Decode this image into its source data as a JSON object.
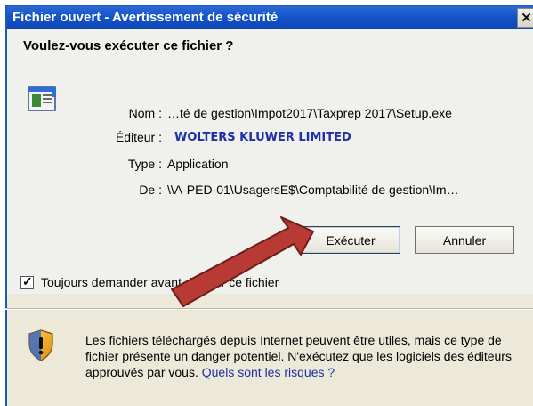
{
  "window": {
    "title": "Fichier ouvert - Avertissement de sécurité",
    "close_label": "✕"
  },
  "dialog": {
    "question": "Voulez-vous exécuter ce fichier ?",
    "details": {
      "name_label": "Nom :",
      "name_value": "…té de gestion\\Impot2017\\Taxprep 2017\\Setup.exe",
      "publisher_label": "Éditeur :",
      "publisher_value": "WOLTERS KLUWER LIMITED",
      "type_label": "Type :",
      "type_value": "Application",
      "from_label": "De :",
      "from_value": "\\\\A-PED-01\\UsagersE$\\Comptabilité de gestion\\Im…"
    },
    "buttons": {
      "run_label": "Exécuter",
      "cancel_label": "Annuler"
    },
    "checkbox": {
      "label": "Toujours demander avant d'ouvrir ce fichier",
      "checked": true
    },
    "warning": {
      "text": "Les fichiers téléchargés depuis Internet peuvent être utiles, mais ce type de fichier présente un danger potentiel. N'exécutez que les logiciels des éditeurs approuvés par vous.",
      "link_label": "Quels sont les risques ?"
    }
  },
  "colors": {
    "titlebar": "#1454c9",
    "link": "#1e2fa8",
    "annotation_arrow": "#b83a34"
  },
  "icons": {
    "app": "application-window-icon",
    "shield": "security-shield-icon",
    "close": "close-icon",
    "check": "check-icon"
  }
}
